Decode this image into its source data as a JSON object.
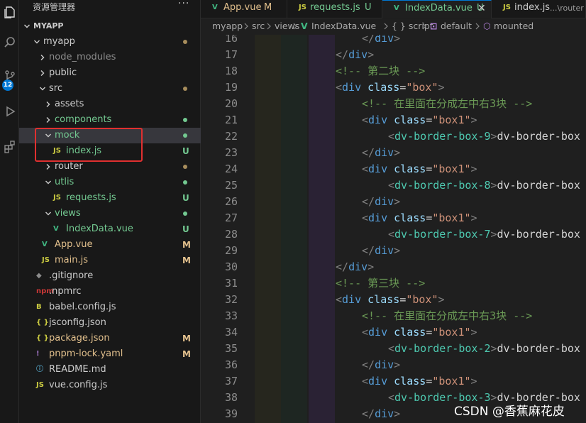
{
  "activity_bar": {
    "items": [
      {
        "name": "explorer-icon"
      },
      {
        "name": "search-icon"
      },
      {
        "name": "source-control-icon",
        "badge": "12"
      },
      {
        "name": "run-debug-icon"
      },
      {
        "name": "extensions-icon"
      }
    ]
  },
  "sidebar": {
    "title": "资源管理器",
    "more": "···",
    "root": "MYAPP",
    "items": [
      {
        "label": "myapp",
        "type": "folder",
        "open": true,
        "status": "dot",
        "color": "#cccccc"
      },
      {
        "label": "node_modules",
        "type": "folder",
        "open": false,
        "status": "",
        "color": "#8c8c8c"
      },
      {
        "label": "public",
        "type": "folder",
        "open": false,
        "status": "",
        "color": "#cccccc"
      },
      {
        "label": "src",
        "type": "folder",
        "open": true,
        "status": "dot",
        "color": "#cccccc"
      },
      {
        "label": "assets",
        "type": "folder",
        "open": false,
        "status": "",
        "color": "#cccccc"
      },
      {
        "label": "components",
        "type": "folder",
        "open": false,
        "status": "dot",
        "color": "#73c991"
      },
      {
        "label": "mock",
        "type": "folder",
        "open": true,
        "status": "dot",
        "color": "#73c991"
      },
      {
        "label": "index.js",
        "type": "js",
        "status": "U",
        "color": "#73c991"
      },
      {
        "label": "router",
        "type": "folder",
        "open": false,
        "status": "dot",
        "color": "#cccccc"
      },
      {
        "label": "utlis",
        "type": "folder",
        "open": true,
        "status": "dot",
        "color": "#73c991"
      },
      {
        "label": "requests.js",
        "type": "js",
        "status": "U",
        "color": "#73c991"
      },
      {
        "label": "views",
        "type": "folder",
        "open": true,
        "status": "dot",
        "color": "#73c991"
      },
      {
        "label": "IndexData.vue",
        "type": "vue",
        "status": "U",
        "color": "#73c991"
      },
      {
        "label": "App.vue",
        "type": "vue",
        "status": "M",
        "color": "#e2c08d"
      },
      {
        "label": "main.js",
        "type": "js",
        "status": "M",
        "color": "#e2c08d"
      },
      {
        "label": ".gitignore",
        "type": "git",
        "status": "",
        "color": "#cccccc"
      },
      {
        "label": ".npmrc",
        "type": "npm",
        "status": "",
        "color": "#cccccc"
      },
      {
        "label": "babel.config.js",
        "type": "babel",
        "status": "",
        "color": "#cccccc"
      },
      {
        "label": "jsconfig.json",
        "type": "json",
        "status": "",
        "color": "#cccccc"
      },
      {
        "label": "package.json",
        "type": "json",
        "status": "M",
        "color": "#e2c08d"
      },
      {
        "label": "pnpm-lock.yaml",
        "type": "yaml",
        "status": "M",
        "color": "#e2c08d"
      },
      {
        "label": "README.md",
        "type": "info",
        "status": "",
        "color": "#cccccc"
      },
      {
        "label": "vue.config.js",
        "type": "js",
        "status": "",
        "color": "#cccccc"
      }
    ],
    "icon_text": {
      "js": "JS",
      "vue": "V",
      "json": "{ }",
      "yaml": "!",
      "info": "ⓘ",
      "babel": "B",
      "npm": "npm",
      "git": "◆"
    }
  },
  "tabs": [
    {
      "label": "App.vue",
      "status": "M",
      "icon": "V",
      "icon_color": "#41b883",
      "label_color": "#e2c08d",
      "active": false
    },
    {
      "label": "requests.js",
      "status": "U",
      "icon": "JS",
      "icon_color": "#cbcb41",
      "label_color": "#73c991",
      "active": false
    },
    {
      "label": "IndexData.vue",
      "status": "U",
      "icon": "V",
      "icon_color": "#41b883",
      "label_color": "#73c991",
      "active": true,
      "close": "✕"
    },
    {
      "label": "index.js",
      "status": "",
      "icon": "JS",
      "icon_color": "#cbcb41",
      "label_color": "#cccccc",
      "active": false,
      "description": "...\\router"
    }
  ],
  "breadcrumb": [
    "myapp",
    "src",
    "views",
    "IndexData.vue",
    "{ } script",
    "default",
    "mounted"
  ],
  "editor": {
    "line_numbers": [
      "16",
      "17",
      "18",
      "19",
      "20",
      "21",
      "22",
      "23",
      "24",
      "25",
      "26",
      "27",
      "28",
      "29",
      "30",
      "31",
      "32",
      "33",
      "34",
      "35",
      "36",
      "37",
      "38",
      "39"
    ],
    "lines": [
      {
        "indent": 1,
        "parts": [
          [
            "punct",
            "</"
          ],
          [
            "tag",
            "div"
          ],
          [
            "punct",
            ">"
          ]
        ]
      },
      {
        "indent": 0,
        "parts": [
          [
            "punct",
            "</"
          ],
          [
            "tag",
            "div"
          ],
          [
            "punct",
            ">"
          ]
        ]
      },
      {
        "indent": 0,
        "parts": [
          [
            "comment",
            "<!-- 第二块 -->"
          ]
        ]
      },
      {
        "indent": 0,
        "parts": [
          [
            "punct",
            "<"
          ],
          [
            "tag",
            "div"
          ],
          [
            "text",
            " "
          ],
          [
            "attr",
            "class"
          ],
          [
            "text",
            "="
          ],
          [
            "str",
            "\"box\""
          ],
          [
            "punct",
            ">"
          ]
        ]
      },
      {
        "indent": 1,
        "parts": [
          [
            "comment",
            "<!-- 在里面在分成左中右3块 -->"
          ]
        ]
      },
      {
        "indent": 1,
        "parts": [
          [
            "punct",
            "<"
          ],
          [
            "tag",
            "div"
          ],
          [
            "text",
            " "
          ],
          [
            "attr",
            "class"
          ],
          [
            "text",
            "="
          ],
          [
            "str",
            "\"box1\""
          ],
          [
            "punct",
            ">"
          ]
        ]
      },
      {
        "indent": 2,
        "parts": [
          [
            "punct",
            "<"
          ],
          [
            "custom",
            "dv-border-box-9"
          ],
          [
            "punct",
            ">"
          ],
          [
            "text",
            "dv-border-box"
          ]
        ]
      },
      {
        "indent": 1,
        "parts": [
          [
            "punct",
            "</"
          ],
          [
            "tag",
            "div"
          ],
          [
            "punct",
            ">"
          ]
        ]
      },
      {
        "indent": 1,
        "parts": [
          [
            "punct",
            "<"
          ],
          [
            "tag",
            "div"
          ],
          [
            "text",
            " "
          ],
          [
            "attr",
            "class"
          ],
          [
            "text",
            "="
          ],
          [
            "str",
            "\"box1\""
          ],
          [
            "punct",
            ">"
          ]
        ]
      },
      {
        "indent": 2,
        "parts": [
          [
            "punct",
            "<"
          ],
          [
            "custom",
            "dv-border-box-8"
          ],
          [
            "punct",
            ">"
          ],
          [
            "text",
            "dv-border-box"
          ]
        ]
      },
      {
        "indent": 1,
        "parts": [
          [
            "punct",
            "</"
          ],
          [
            "tag",
            "div"
          ],
          [
            "punct",
            ">"
          ]
        ]
      },
      {
        "indent": 1,
        "parts": [
          [
            "punct",
            "<"
          ],
          [
            "tag",
            "div"
          ],
          [
            "text",
            " "
          ],
          [
            "attr",
            "class"
          ],
          [
            "text",
            "="
          ],
          [
            "str",
            "\"box1\""
          ],
          [
            "punct",
            ">"
          ]
        ]
      },
      {
        "indent": 2,
        "parts": [
          [
            "punct",
            "<"
          ],
          [
            "custom",
            "dv-border-box-7"
          ],
          [
            "punct",
            ">"
          ],
          [
            "text",
            "dv-border-box"
          ]
        ]
      },
      {
        "indent": 1,
        "parts": [
          [
            "punct",
            "</"
          ],
          [
            "tag",
            "div"
          ],
          [
            "punct",
            ">"
          ]
        ]
      },
      {
        "indent": 0,
        "parts": [
          [
            "punct",
            "</"
          ],
          [
            "tag",
            "div"
          ],
          [
            "punct",
            ">"
          ]
        ]
      },
      {
        "indent": 0,
        "parts": [
          [
            "comment",
            "<!-- 第三块 -->"
          ]
        ]
      },
      {
        "indent": 0,
        "parts": [
          [
            "punct",
            "<"
          ],
          [
            "tag",
            "div"
          ],
          [
            "text",
            " "
          ],
          [
            "attr",
            "class"
          ],
          [
            "text",
            "="
          ],
          [
            "str",
            "\"box\""
          ],
          [
            "punct",
            ">"
          ]
        ]
      },
      {
        "indent": 1,
        "parts": [
          [
            "comment",
            "<!-- 在里面在分成左中右3块 -->"
          ]
        ]
      },
      {
        "indent": 1,
        "parts": [
          [
            "punct",
            "<"
          ],
          [
            "tag",
            "div"
          ],
          [
            "text",
            " "
          ],
          [
            "attr",
            "class"
          ],
          [
            "text",
            "="
          ],
          [
            "str",
            "\"box1\""
          ],
          [
            "punct",
            ">"
          ]
        ]
      },
      {
        "indent": 2,
        "parts": [
          [
            "punct",
            "<"
          ],
          [
            "custom",
            "dv-border-box-2"
          ],
          [
            "punct",
            ">"
          ],
          [
            "text",
            "dv-border-box"
          ]
        ]
      },
      {
        "indent": 1,
        "parts": [
          [
            "punct",
            "</"
          ],
          [
            "tag",
            "div"
          ],
          [
            "punct",
            ">"
          ]
        ]
      },
      {
        "indent": 1,
        "parts": [
          [
            "punct",
            "<"
          ],
          [
            "tag",
            "div"
          ],
          [
            "text",
            " "
          ],
          [
            "attr",
            "class"
          ],
          [
            "text",
            "="
          ],
          [
            "str",
            "\"box1\""
          ],
          [
            "punct",
            ">"
          ]
        ]
      },
      {
        "indent": 2,
        "parts": [
          [
            "punct",
            "<"
          ],
          [
            "custom",
            "dv-border-box-3"
          ],
          [
            "punct",
            ">"
          ],
          [
            "text",
            "dv-border-box"
          ]
        ]
      },
      {
        "indent": 1,
        "parts": [
          [
            "punct",
            "</"
          ],
          [
            "tag",
            "div"
          ],
          [
            "punct",
            ">"
          ]
        ]
      }
    ]
  },
  "watermark": "CSDN @香蕉麻花皮"
}
